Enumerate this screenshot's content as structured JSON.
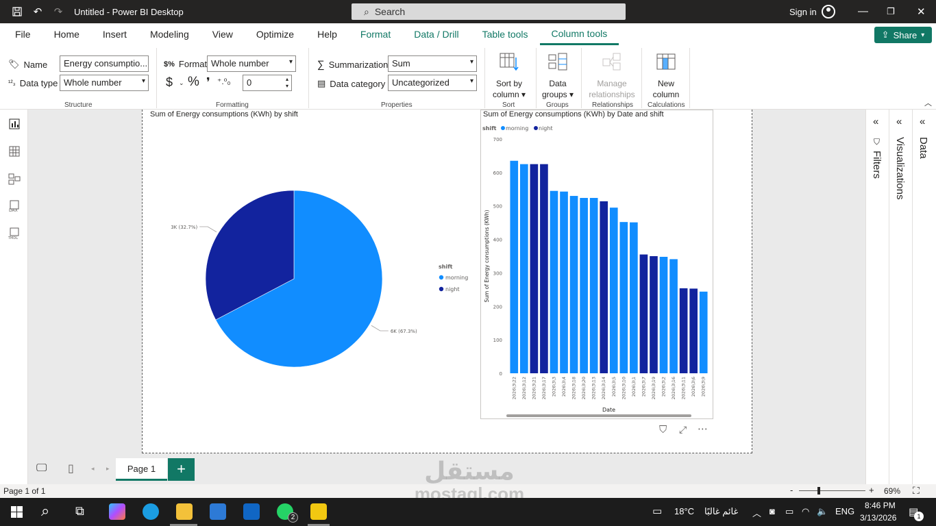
{
  "window": {
    "title": "Untitled - Power BI Desktop",
    "search_placeholder": "Search",
    "signin": "Sign in"
  },
  "menu": {
    "tabs": [
      "File",
      "Home",
      "Insert",
      "Modeling",
      "View",
      "Optimize",
      "Help",
      "Format",
      "Data / Drill",
      "Table tools",
      "Column tools"
    ],
    "active": "Column tools",
    "share_label": "Share"
  },
  "ribbon": {
    "structure": {
      "name_label": "Name",
      "name_value": "Energy consumptio...",
      "datatype_label": "Data type",
      "datatype_value": "Whole number",
      "group_label": "Structure"
    },
    "formatting": {
      "format_label": "Format",
      "format_value": "Whole number",
      "currency_symbol": "$",
      "percent_symbol": "%",
      "comma_symbol": "❜",
      "decimals_value": "0",
      "group_label": "Formatting"
    },
    "properties": {
      "summarization_label": "Summarization",
      "summarization_value": "Sum",
      "category_label": "Data category",
      "category_value": "Uncategorized",
      "group_label": "Properties"
    },
    "sort": {
      "line1": "Sort by",
      "line2": "column",
      "group_label": "Sort"
    },
    "groups": {
      "line1": "Data",
      "line2": "groups",
      "group_label": "Groups"
    },
    "relationships": {
      "line1": "Manage",
      "line2": "relationships",
      "group_label": "Relationships"
    },
    "calculations": {
      "line1": "New",
      "line2": "column",
      "group_label": "Calculations"
    }
  },
  "panes": {
    "filters": "Filters",
    "visualizations": "Visualizations",
    "data": "Data"
  },
  "pages": {
    "tab": "Page 1",
    "add": "+"
  },
  "status": {
    "page": "Page 1 of 1",
    "zoom": "69%",
    "zoom_minus": "-",
    "zoom_plus": "+"
  },
  "taskbar": {
    "temp": "18°C",
    "weather": "غائم غالبًا",
    "lang": "ENG",
    "time": "8:46 PM",
    "date": "3/13/2026",
    "whatsapp_badge": "2",
    "notif_badge": "1"
  },
  "watermark": {
    "arabic": "مستقل",
    "latin": "mostaql.com"
  },
  "colors": {
    "morning": "#118dff",
    "night": "#12239e",
    "accent": "#117865"
  },
  "chart_data": [
    {
      "type": "pie",
      "title": "Sum of Energy consumptions (KWh) by shift",
      "legend_title": "shift",
      "legend_position": "right",
      "slices": [
        {
          "name": "morning",
          "value": 67.3,
          "label": "6K (67.3%)"
        },
        {
          "name": "night",
          "value": 32.7,
          "label": "3K (32.7%)"
        }
      ]
    },
    {
      "type": "bar",
      "title": "Sum of Energy consumptions (KWh) by Date and shift",
      "legend_title": "shift",
      "legend_position": "top-left",
      "legend": [
        "morning",
        "night"
      ],
      "xlabel": "Date",
      "ylabel": "Sum of Energy consumptions (KWh)",
      "ylim": [
        0,
        700
      ],
      "yticks": [
        0,
        100,
        200,
        300,
        400,
        500,
        600,
        700
      ],
      "categories": [
        "2026\\3\\22",
        "2026\\3\\12",
        "2026\\3\\21",
        "2026\\3\\17",
        "2026\\3\\3",
        "2026\\3\\4",
        "2026\\3\\18",
        "2026\\3\\20",
        "2026\\3\\13",
        "2026\\3\\14",
        "2026\\3\\5",
        "2026\\3\\10",
        "2026\\3\\1",
        "2026\\3\\7",
        "2026\\3\\19",
        "2026\\3\\2",
        "2026\\3\\16",
        "2026\\3\\11",
        "2026\\3\\6",
        "2026\\3\\9"
      ],
      "values": [
        635,
        625,
        625,
        625,
        545,
        543,
        530,
        524,
        524,
        514,
        495,
        452,
        451,
        355,
        350,
        348,
        341,
        254,
        253,
        244
      ],
      "shift": [
        "morning",
        "morning",
        "night",
        "night",
        "morning",
        "morning",
        "morning",
        "morning",
        "morning",
        "night",
        "morning",
        "morning",
        "morning",
        "night",
        "night",
        "morning",
        "morning",
        "night",
        "night",
        "morning"
      ]
    }
  ]
}
